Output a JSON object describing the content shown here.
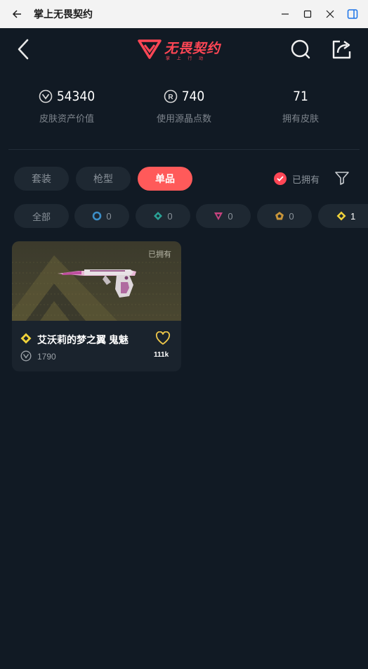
{
  "window": {
    "title": "掌上无畏契约"
  },
  "header": {
    "brand": "无畏契约",
    "brand_sub": "掌 上 行 动"
  },
  "stats": [
    {
      "value": "54340",
      "label": "皮肤资产价值",
      "icon": "valorant-points-icon"
    },
    {
      "value": "740",
      "label": "使用源晶点数",
      "icon": "radianite-icon"
    },
    {
      "value": "71",
      "label": "拥有皮肤",
      "icon": ""
    }
  ],
  "tabs": [
    {
      "label": "套装",
      "active": false
    },
    {
      "label": "枪型",
      "active": false
    },
    {
      "label": "单品",
      "active": true
    }
  ],
  "owned_filter": {
    "label": "已拥有",
    "checked": true
  },
  "tiers": {
    "all": "全部",
    "items": [
      {
        "name": "select",
        "count": "0",
        "color": "#3c8ec7"
      },
      {
        "name": "deluxe",
        "count": "0",
        "color": "#2aa195"
      },
      {
        "name": "premium",
        "count": "0",
        "color": "#c8437f"
      },
      {
        "name": "exclusive",
        "count": "0",
        "color": "#c8953a"
      },
      {
        "name": "ultra",
        "count": "1",
        "color": "#f0d23a"
      }
    ]
  },
  "skins": [
    {
      "owned_tag": "已拥有",
      "name": "艾沃莉的梦之翼 鬼魅",
      "price": "1790",
      "likes": "111k",
      "tier_color": "#f0d23a"
    }
  ],
  "colors": {
    "accent": "#ff4655",
    "active_pill": "#ff5a5a",
    "background": "#111a24"
  }
}
